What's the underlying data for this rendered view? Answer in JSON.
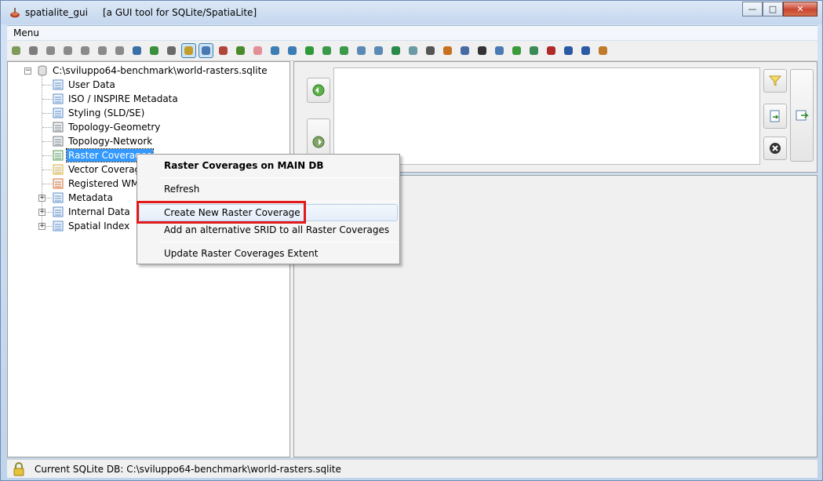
{
  "window": {
    "title": "spatialite_gui     [a GUI tool for SQLite/SpatiaLite]",
    "minimize_glyph": "—",
    "maximize_glyph": "□",
    "close_glyph": "✕"
  },
  "menubar": {
    "menu_label": "Menu"
  },
  "toolbar": {
    "icons": [
      "connect-icon",
      "disconnect-icon",
      "create-db-icon",
      "memory-db-icon",
      "memory-db-icon",
      "memory-db-icon",
      "memory-db-icon",
      "plugin-icon",
      "vacuum-icon",
      "sql-script-icon",
      "sql-run-icon",
      "query-view-composer-icon",
      "chart-icon",
      "debug-icon",
      "attach-icon",
      "load-shp-icon",
      "load-txt-icon",
      "network-icon",
      "import-icon",
      "import-icon",
      "export-icon",
      "export-icon",
      "excel-icon",
      "mosaic-icon",
      "eye-icon",
      "topology-icon",
      "raster-icon",
      "list-icon",
      "wms-icon",
      "check-icon",
      "srid-icon",
      "text-icon",
      "help-icon",
      "about-icon",
      "exit-icon"
    ],
    "pressed": [
      10,
      11
    ]
  },
  "tree": {
    "root": "C:\\sviluppo64-benchmark\\world-rasters.sqlite",
    "nodes": [
      {
        "label": "User Data",
        "icon": "table-icon",
        "expandable": false
      },
      {
        "label": "ISO / INSPIRE Metadata",
        "icon": "table-icon",
        "expandable": false
      },
      {
        "label": "Styling (SLD/SE)",
        "icon": "table-icon",
        "expandable": false
      },
      {
        "label": "Topology-Geometry",
        "icon": "topology-icon",
        "expandable": false
      },
      {
        "label": "Topology-Network",
        "icon": "network-icon",
        "expandable": false
      },
      {
        "label": "Raster Coverages",
        "icon": "raster-icon",
        "expandable": false,
        "selected": true
      },
      {
        "label": "Vector Coverages",
        "icon": "vector-icon",
        "expandable": false
      },
      {
        "label": "Registered WMS",
        "icon": "wms-icon",
        "expandable": false
      },
      {
        "label": "Metadata",
        "icon": "table-icon",
        "expandable": true
      },
      {
        "label": "Internal Data",
        "icon": "table-icon",
        "expandable": true
      },
      {
        "label": "Spatial Index",
        "icon": "table-icon",
        "expandable": true
      }
    ]
  },
  "context_menu": {
    "header": "Raster Coverages on MAIN DB",
    "items": [
      "Refresh",
      "Create New Raster Coverage",
      "Add an alternative SRID to all Raster Coverages",
      "Update Raster Coverages Extent"
    ]
  },
  "sql_panel": {
    "editor_value": "",
    "buttons": [
      "history-back-icon",
      "history-forward-icon",
      "filter-icon",
      "load-sql-icon",
      "clear-icon",
      "execute-icon"
    ]
  },
  "statusbar": {
    "text": "Current SQLite DB: C:\\sviluppo64-benchmark\\world-rasters.sqlite"
  },
  "colors": {
    "highlight": "#e21a1a",
    "selection": "#3399ff"
  }
}
